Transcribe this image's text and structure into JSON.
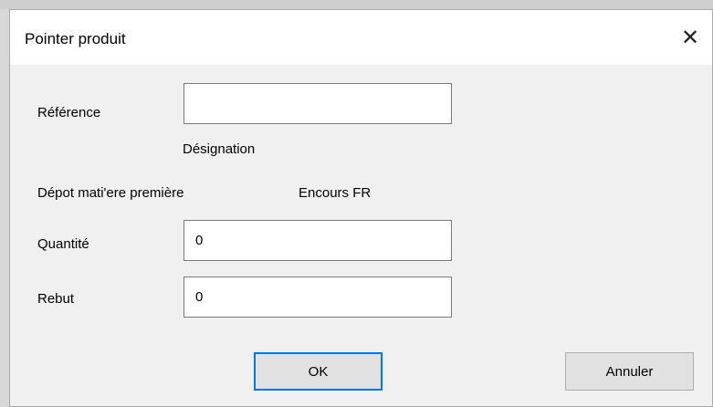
{
  "dialog": {
    "title": "Pointer produit",
    "close_glyph": "✕"
  },
  "form": {
    "reference_label": "Référence",
    "reference_value": "",
    "designation_label": "Désignation",
    "depot_label": "Dépot mati'ere première",
    "depot_value": "Encours FR",
    "quantite_label": "Quantité",
    "quantite_value": "0",
    "rebut_label": "Rebut",
    "rebut_value": "0"
  },
  "buttons": {
    "ok_label": "OK",
    "cancel_label": "Annuler"
  },
  "colors": {
    "dialog_bg": "#f0f0f0",
    "titlebar_bg": "#ffffff",
    "default_button_border": "#0078d7",
    "button_bg": "#e1e1e1"
  },
  "icons": {
    "close": "close-icon"
  }
}
